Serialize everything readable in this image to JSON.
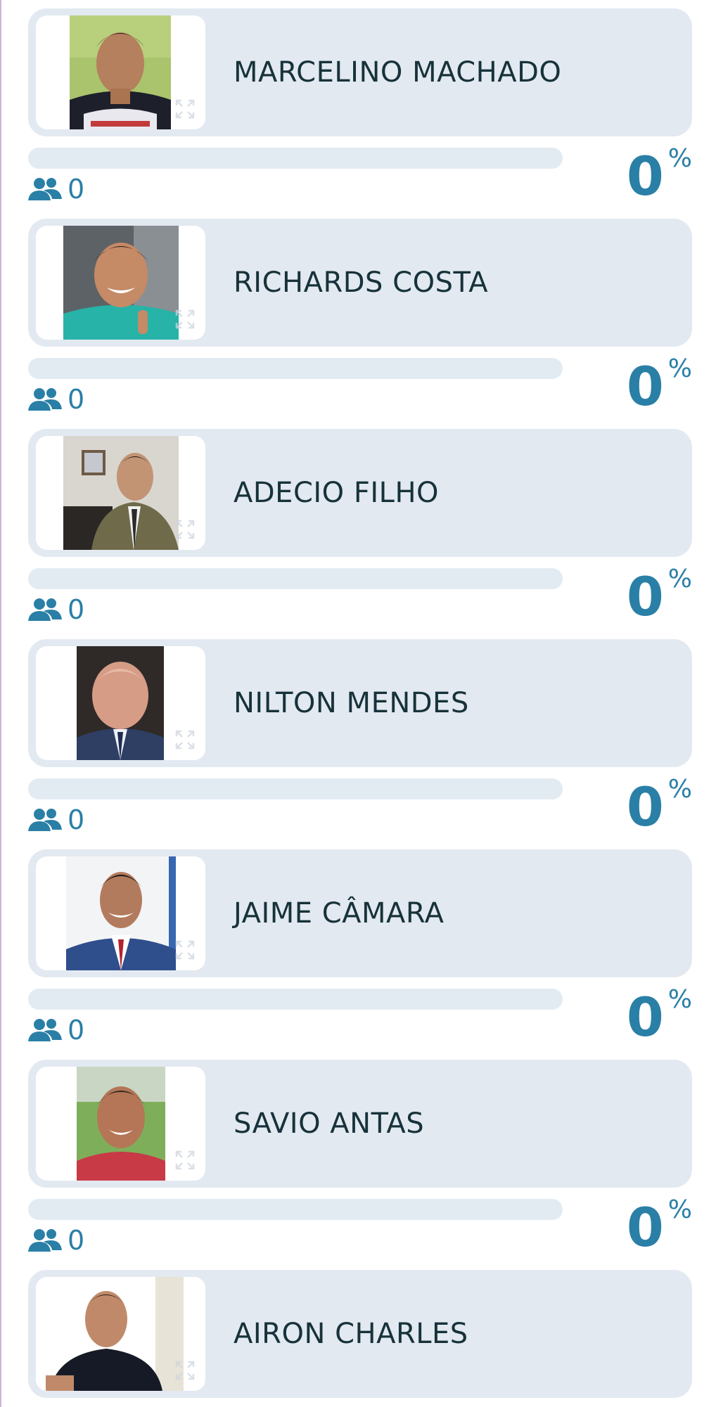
{
  "colors": {
    "accent": "#2a7fa6",
    "card_background": "#e3e9f1",
    "bar_background": "#e3ebf2",
    "name_text": "#17323a"
  },
  "icons": {
    "votes": "users-icon",
    "photo_action": "expand-icon"
  },
  "percent_sign": "%",
  "candidates": [
    {
      "name": "MARCELINO MACHADO",
      "votes": "0",
      "percent": "0",
      "progress": 0
    },
    {
      "name": "RICHARDS COSTA",
      "votes": "0",
      "percent": "0",
      "progress": 0
    },
    {
      "name": "ADECIO FILHO",
      "votes": "0",
      "percent": "0",
      "progress": 0
    },
    {
      "name": "NILTON MENDES",
      "votes": "0",
      "percent": "0",
      "progress": 0
    },
    {
      "name": "JAIME CÂMARA",
      "votes": "0",
      "percent": "0",
      "progress": 0
    },
    {
      "name": "SAVIO ANTAS",
      "votes": "0",
      "percent": "0",
      "progress": 0
    },
    {
      "name": "AIRON CHARLES"
    }
  ]
}
